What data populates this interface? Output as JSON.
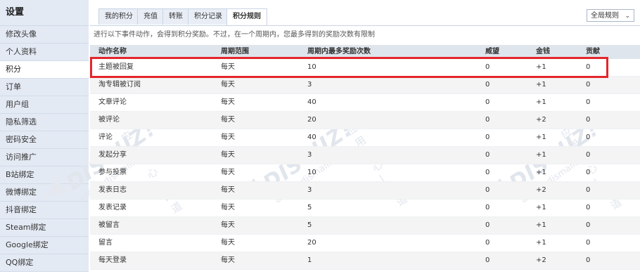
{
  "sidebar": {
    "title": "设置",
    "items": [
      {
        "label": "修改头像"
      },
      {
        "label": "个人资料"
      },
      {
        "label": "积分"
      },
      {
        "label": "订单"
      },
      {
        "label": "用户组"
      },
      {
        "label": "隐私筛选"
      },
      {
        "label": "密码安全"
      },
      {
        "label": "访问推广"
      },
      {
        "label": "B站绑定"
      },
      {
        "label": "微博绑定"
      },
      {
        "label": "抖音绑定"
      },
      {
        "label": "Steam绑定"
      },
      {
        "label": "Google绑定"
      },
      {
        "label": "QQ绑定"
      }
    ],
    "active_index": 2
  },
  "tabs": [
    {
      "label": "我的积分"
    },
    {
      "label": "充值"
    },
    {
      "label": "转账"
    },
    {
      "label": "积分记录"
    },
    {
      "label": "积分规则"
    }
  ],
  "active_tab_index": 4,
  "scope_select": {
    "value": "全局规则"
  },
  "description": "进行以下事件动作，会得到积分奖励。不过，在一个周期内，您最多得到的奖励次数有限制",
  "table": {
    "headers": [
      "动作名称",
      "周期范围",
      "周期内最多奖励次数",
      "威望",
      "金钱",
      "贡献"
    ],
    "rows": [
      [
        "主题被回复",
        "每天",
        "10",
        "0",
        "+1",
        "0"
      ],
      [
        "淘专辑被订阅",
        "每天",
        "3",
        "0",
        "+1",
        "0"
      ],
      [
        "文章评论",
        "每天",
        "40",
        "0",
        "+1",
        "0"
      ],
      [
        "被评论",
        "每天",
        "20",
        "0",
        "+2",
        "0"
      ],
      [
        "评论",
        "每天",
        "40",
        "0",
        "+1",
        "0"
      ],
      [
        "发起分享",
        "每天",
        "3",
        "0",
        "+1",
        "0"
      ],
      [
        "参与投票",
        "每天",
        "10",
        "0",
        "+1",
        "0"
      ],
      [
        "发表日志",
        "每天",
        "3",
        "0",
        "+2",
        "0"
      ],
      [
        "发表记录",
        "每天",
        "5",
        "0",
        "+1",
        "0"
      ],
      [
        "被留言",
        "每天",
        "5",
        "0",
        "+1",
        "0"
      ],
      [
        "留言",
        "每天",
        "20",
        "0",
        "+1",
        "0"
      ],
      [
        "每天登录",
        "每天",
        "1",
        "0",
        "+2",
        "0"
      ]
    ],
    "highlighted_row_index": 0
  },
  "watermark": {
    "brand": "DISCUZ!",
    "text": "应用中心 | 武道",
    "url": "addon.dismall.com"
  },
  "colors": {
    "sidebar_bg": "#e4eaf4",
    "highlight": "#e4262b",
    "header_bg": "#dfe5ec"
  },
  "icons": {
    "select": "chevron-down-icon"
  }
}
